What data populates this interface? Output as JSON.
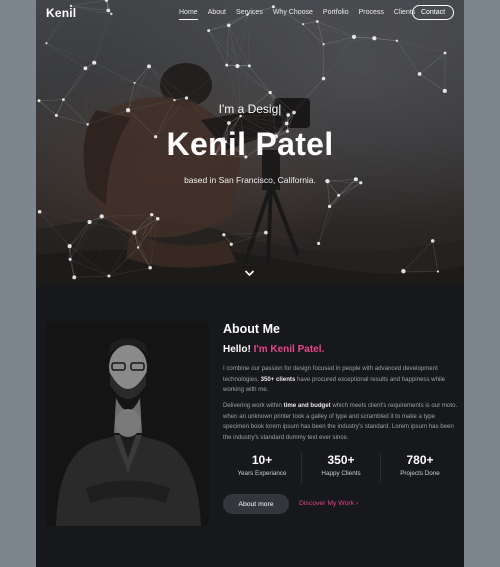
{
  "header": {
    "logo": "Kenil",
    "nav": [
      {
        "label": "Home",
        "active": true
      },
      {
        "label": "About",
        "active": false
      },
      {
        "label": "Services",
        "active": false
      },
      {
        "label": "Why Choose",
        "active": false
      },
      {
        "label": "Portfolio",
        "active": false
      },
      {
        "label": "Process",
        "active": false
      },
      {
        "label": "Clients",
        "active": false
      }
    ],
    "contact_label": "Contact"
  },
  "hero": {
    "intro": "I'm a Desig|",
    "name": "Kenil Patel",
    "location": "based in San Francisco, California."
  },
  "about": {
    "title": "About Me",
    "hello_prefix": "Hello! ",
    "hello_name": "I'm Kenil Patel.",
    "p1_a": "I combine our passion for design focused in people with advanced development technologies. ",
    "p1_b": "350+ clients",
    "p1_c": " have procured exceptional results and happiness while working with me.",
    "p2_a": "Delivering work within ",
    "p2_b": "time and budget",
    "p2_c": " which meets client's requirements is our moto. when an unknown printer took a galley of type and scrambled it to make a type specimen book lorem ipsum has been the industry's standard. Lorem ipsum has been the industry's standard dummy text ever since.",
    "stats": [
      {
        "num": "10+",
        "label": "Years Experiance"
      },
      {
        "num": "350+",
        "label": "Happy Clients"
      },
      {
        "num": "780+",
        "label": "Projects Done"
      }
    ],
    "more_label": "About more",
    "discover_label": "Discover My Work",
    "accent": "#e8468b"
  }
}
